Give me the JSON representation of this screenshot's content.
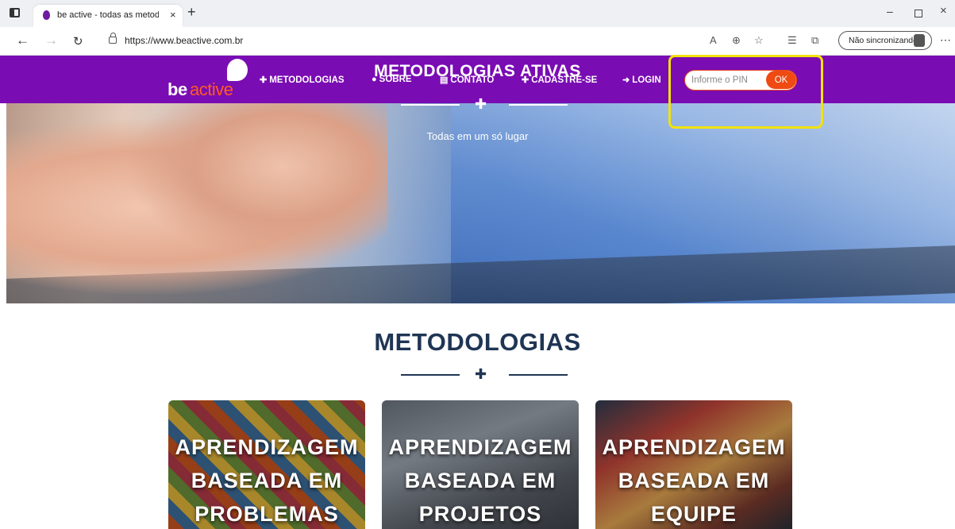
{
  "browser": {
    "tab_title": "be active - todas as metodologias",
    "tab_close": "×",
    "new_tab": "+",
    "url": "https://www.beactive.com.br",
    "sync_label": "Não sincronizando",
    "window_min": "–",
    "window_close": "×"
  },
  "site": {
    "logo_be": "be",
    "logo_active": "active",
    "menu": [
      {
        "icon": "puzzle-icon",
        "glyph": "✚",
        "label": "METODOLOGIAS"
      },
      {
        "icon": "info-icon",
        "glyph": "●",
        "label": "SOBRE"
      },
      {
        "icon": "contact-card-icon",
        "glyph": "▤",
        "label": "CONTATO"
      },
      {
        "icon": "add-user-icon",
        "glyph": "✚",
        "label": "CADASTRE-SE"
      },
      {
        "icon": "login-icon",
        "glyph": "➜",
        "label": "LOGIN"
      }
    ],
    "pin_placeholder": "Informe o PIN",
    "pin_button": "OK",
    "brand_color": "#7a0cb3",
    "accent_color": "#ee4a12",
    "highlight_color": "#f1e20c"
  },
  "hero": {
    "title": "METODOLOGIAS ATIVAS",
    "subtitle": "Todas em um só lugar",
    "divider_icon": "puzzle-icon"
  },
  "section": {
    "title": "METODOLOGIAS",
    "divider_icon": "puzzle-icon",
    "cards": [
      {
        "line1": "APRENDIZAGEM",
        "line2": "BASEADA EM",
        "line3": "PROBLEMAS"
      },
      {
        "line1": "APRENDIZAGEM",
        "line2": "BASEADA EM",
        "line3": "PROJETOS"
      },
      {
        "line1": "APRENDIZAGEM",
        "line2": "BASEADA EM",
        "line3": "EQUIPE"
      }
    ]
  }
}
